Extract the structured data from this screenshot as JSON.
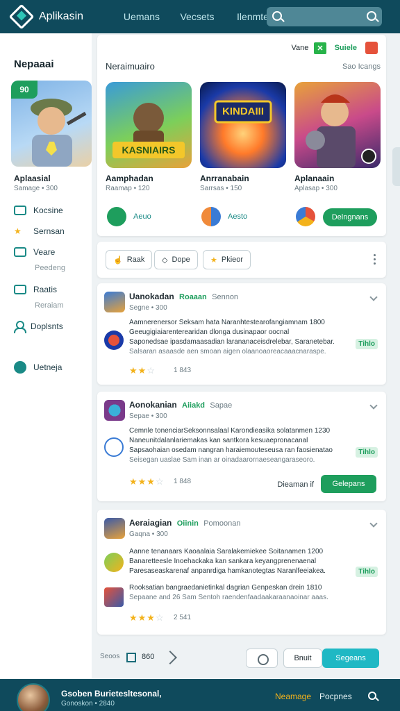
{
  "topbar": {
    "title": "Aplikasin",
    "nav": [
      "Uemans",
      "Vecsets",
      "Ilenmte"
    ]
  },
  "sidebar": {
    "title": "Nepaaai",
    "featured_badge": "90",
    "featured_name": "Aplaasial",
    "featured_meta": "Samage • 300",
    "items": [
      {
        "label": "Kocsine"
      },
      {
        "label": "Sernsan"
      },
      {
        "label": "Veare",
        "sub": "Peedeng"
      },
      {
        "label": "Raatis",
        "sub": "Reraiam"
      },
      {
        "label": "Doplsnts"
      },
      {
        "label": "Uetneja"
      }
    ]
  },
  "featured": {
    "tags": {
      "label": "Vane",
      "green": "Suiele"
    },
    "section_title": "Neraimuairo",
    "see_all": "Sao Icangs",
    "games": [
      {
        "name": "Aamphadan",
        "meta": "Raamap • 120",
        "tile_text": "KASNIAIRS",
        "action": "Aeuo"
      },
      {
        "name": "Anrranabain",
        "meta": "Sarrsas • 150",
        "tile_text": "KINDAIII",
        "action": "Aesto"
      },
      {
        "name": "Aplanaain",
        "meta": "Aplasap • 300",
        "tile_text": "",
        "action": ""
      }
    ],
    "download_label": "Delngnans"
  },
  "filters": {
    "items": [
      "Raak",
      "Dope",
      "Pkieor"
    ]
  },
  "reviews": [
    {
      "name": "Uanokadan",
      "badge": "Roaaan",
      "badge2": "Sennon",
      "sub": "Segne • 300",
      "lines": [
        "Aamnerenersor Seksam hata Naranhtestearofangiamnam 1800",
        "Geeugigiaiarenterearidan dlonga dusinapaor oocnal",
        "Saponedsae ipasdamaasadian larananaceisdrelebar, Saranetebar.",
        "Salsaran asaasde aen smoan aigen olaanoaoreacaaacnaraspe."
      ],
      "tag": "Tihlo",
      "rating": 2,
      "count": "1 843"
    },
    {
      "name": "Aonokanian",
      "badge": "Aiiakd",
      "badge2": "Sapae",
      "sub": "Sepae • 300",
      "lines": [
        "Cemnle tonenciarSeksonnsalaal Karondieasika solatanmen 1230",
        "Naneunitdalanlariemakas kan santkora kesuaepronacanal",
        "Sapsaohaian osedam nangran haraiemouteseusa ran faosienatao",
        "Seisegan uaslae Sam inan ar oinadaarornaeseangaraseoro."
      ],
      "tag": "Tihlo",
      "rating": 3,
      "count": "1 848",
      "link": "Dieaman if",
      "button": "Gelepans"
    },
    {
      "name": "Aeraiagian",
      "badge": "Oiinin",
      "badge2": "Pomoonan",
      "sub": "Gaqna • 300",
      "lines": [
        "Aanne tenanaars Kaoaalaia Saralakemiekee Soitanamen 1200",
        "Banaretteesle Inoehackaka kan sankara keyangprenenaenal",
        "Paresaseaskarenaf anpanrdiga hamkanotegtas Naranlfeeiakea.",
        "Rooksatian bangraedanietinkal dagrian Genpeskan drein 1810",
        "Sepaane and 26 Sam Sentoh raendenfaadaakaraanaoinar aaas."
      ],
      "tag": "Tihlo",
      "rating": 3,
      "count": "2 541"
    }
  ],
  "actionbar": {
    "left_label": "Seoos",
    "num": "860",
    "exit": "Bnuit",
    "primary": "Segeans"
  },
  "bottombar": {
    "name": "Gsoben Burietesltesonal,",
    "sub": "Gonoskon • 2840",
    "link1": "Neamage",
    "link2": "Pocpnes"
  }
}
